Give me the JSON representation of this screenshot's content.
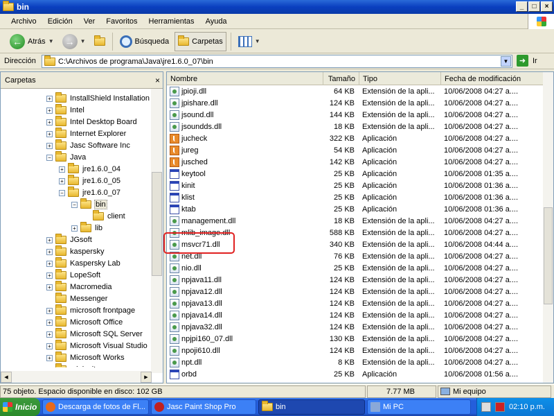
{
  "window": {
    "title": "bin",
    "min": "_",
    "max": "□",
    "close": "×"
  },
  "menu": [
    "Archivo",
    "Edición",
    "Ver",
    "Favoritos",
    "Herramientas",
    "Ayuda"
  ],
  "toolbar": {
    "back": "Atrás",
    "search": "Búsqueda",
    "folders": "Carpetas",
    "back_glyph": "←",
    "fwd_glyph": "→",
    "caret": "▼"
  },
  "address": {
    "label": "Dirección",
    "path": "C:\\Archivos de programa\\Java\\jre1.6.0_07\\bin",
    "go": "Ir",
    "go_glyph": "➜"
  },
  "folders_pane": {
    "title": "Carpetas",
    "close": "×"
  },
  "tree": [
    {
      "label": "InstallShield Installation I",
      "depth": 0,
      "exp": "+"
    },
    {
      "label": "Intel",
      "depth": 0,
      "exp": "+"
    },
    {
      "label": "Intel Desktop Board",
      "depth": 0,
      "exp": "+"
    },
    {
      "label": "Internet Explorer",
      "depth": 0,
      "exp": "+"
    },
    {
      "label": "Jasc Software Inc",
      "depth": 0,
      "exp": "+"
    },
    {
      "label": "Java",
      "depth": 0,
      "exp": "−"
    },
    {
      "label": "jre1.6.0_04",
      "depth": 1,
      "exp": "+"
    },
    {
      "label": "jre1.6.0_05",
      "depth": 1,
      "exp": "+"
    },
    {
      "label": "jre1.6.0_07",
      "depth": 1,
      "exp": "−"
    },
    {
      "label": "bin",
      "depth": 2,
      "exp": "−",
      "selected": true
    },
    {
      "label": "client",
      "depth": 3,
      "exp": ""
    },
    {
      "label": "lib",
      "depth": 2,
      "exp": "+"
    },
    {
      "label": "JGsoft",
      "depth": 0,
      "exp": "+"
    },
    {
      "label": "kaspersky",
      "depth": 0,
      "exp": "+"
    },
    {
      "label": "Kaspersky Lab",
      "depth": 0,
      "exp": "+"
    },
    {
      "label": "LopeSoft",
      "depth": 0,
      "exp": "+"
    },
    {
      "label": "Macromedia",
      "depth": 0,
      "exp": "+"
    },
    {
      "label": "Messenger",
      "depth": 0,
      "exp": ""
    },
    {
      "label": "microsoft frontpage",
      "depth": 0,
      "exp": "+"
    },
    {
      "label": "Microsoft Office",
      "depth": 0,
      "exp": "+"
    },
    {
      "label": "Microsoft SQL Server",
      "depth": 0,
      "exp": "+"
    },
    {
      "label": "Microsoft Visual Studio",
      "depth": 0,
      "exp": "+"
    },
    {
      "label": "Microsoft Works",
      "depth": 0,
      "exp": "+"
    },
    {
      "label": "miniwrite",
      "depth": 0,
      "exp": ""
    }
  ],
  "columns": {
    "name": "Nombre",
    "size": "Tamaño",
    "type": "Tipo",
    "modified": "Fecha de modificación"
  },
  "files": [
    {
      "name": "jpioji.dll",
      "size": "64 KB",
      "type": "Extensión de la apli...",
      "date": "10/06/2008 04:27 a....",
      "icon": "dll"
    },
    {
      "name": "jpishare.dll",
      "size": "124 KB",
      "type": "Extensión de la apli...",
      "date": "10/06/2008 04:27 a....",
      "icon": "dll"
    },
    {
      "name": "jsound.dll",
      "size": "144 KB",
      "type": "Extensión de la apli...",
      "date": "10/06/2008 04:27 a....",
      "icon": "dll"
    },
    {
      "name": "jsoundds.dll",
      "size": "18 KB",
      "type": "Extensión de la apli...",
      "date": "10/06/2008 04:27 a....",
      "icon": "dll"
    },
    {
      "name": "jucheck",
      "size": "322 KB",
      "type": "Aplicación",
      "date": "10/06/2008 04:27 a....",
      "icon": "java"
    },
    {
      "name": "jureg",
      "size": "54 KB",
      "type": "Aplicación",
      "date": "10/06/2008 04:27 a....",
      "icon": "java"
    },
    {
      "name": "jusched",
      "size": "142 KB",
      "type": "Aplicación",
      "date": "10/06/2008 04:27 a....",
      "icon": "java"
    },
    {
      "name": "keytool",
      "size": "25 KB",
      "type": "Aplicación",
      "date": "10/06/2008 01:35 a....",
      "icon": "exe"
    },
    {
      "name": "kinit",
      "size": "25 KB",
      "type": "Aplicación",
      "date": "10/06/2008 01:36 a....",
      "icon": "exe"
    },
    {
      "name": "klist",
      "size": "25 KB",
      "type": "Aplicación",
      "date": "10/06/2008 01:36 a....",
      "icon": "exe"
    },
    {
      "name": "ktab",
      "size": "25 KB",
      "type": "Aplicación",
      "date": "10/06/2008 01:36 a....",
      "icon": "exe"
    },
    {
      "name": "management.dll",
      "size": "18 KB",
      "type": "Extensión de la apli...",
      "date": "10/06/2008 04:27 a....",
      "icon": "dll"
    },
    {
      "name": "mlib_image.dll",
      "size": "588 KB",
      "type": "Extensión de la apli...",
      "date": "10/06/2008 04:27 a....",
      "icon": "dll"
    },
    {
      "name": "msvcr71.dll",
      "size": "340 KB",
      "type": "Extensión de la apli...",
      "date": "10/06/2008 04:44 a....",
      "icon": "dll"
    },
    {
      "name": "net.dll",
      "size": "76 KB",
      "type": "Extensión de la apli...",
      "date": "10/06/2008 04:27 a....",
      "icon": "dll"
    },
    {
      "name": "nio.dll",
      "size": "25 KB",
      "type": "Extensión de la apli...",
      "date": "10/06/2008 04:27 a....",
      "icon": "dll"
    },
    {
      "name": "npjava11.dll",
      "size": "124 KB",
      "type": "Extensión de la apli...",
      "date": "10/06/2008 04:27 a....",
      "icon": "dll"
    },
    {
      "name": "npjava12.dll",
      "size": "124 KB",
      "type": "Extensión de la apli...",
      "date": "10/06/2008 04:27 a....",
      "icon": "dll"
    },
    {
      "name": "npjava13.dll",
      "size": "124 KB",
      "type": "Extensión de la apli...",
      "date": "10/06/2008 04:27 a....",
      "icon": "dll"
    },
    {
      "name": "npjava14.dll",
      "size": "124 KB",
      "type": "Extensión de la apli...",
      "date": "10/06/2008 04:27 a....",
      "icon": "dll"
    },
    {
      "name": "npjava32.dll",
      "size": "124 KB",
      "type": "Extensión de la apli...",
      "date": "10/06/2008 04:27 a....",
      "icon": "dll"
    },
    {
      "name": "npjpi160_07.dll",
      "size": "130 KB",
      "type": "Extensión de la apli...",
      "date": "10/06/2008 04:27 a....",
      "icon": "dll"
    },
    {
      "name": "npoji610.dll",
      "size": "124 KB",
      "type": "Extensión de la apli...",
      "date": "10/06/2008 04:27 a....",
      "icon": "dll"
    },
    {
      "name": "npt.dll",
      "size": "8 KB",
      "type": "Extensión de la apli...",
      "date": "10/06/2008 04:27 a....",
      "icon": "dll"
    },
    {
      "name": "orbd",
      "size": "25 KB",
      "type": "Aplicación",
      "date": "10/06/2008 01:56 a....",
      "icon": "exe"
    }
  ],
  "status": {
    "objects": "75 objeto. Espacio disponible en disco: 102 GB",
    "size": "7.77 MB",
    "location": "Mi equipo"
  },
  "taskbar": {
    "start": "Inicio",
    "tasks": [
      {
        "label": "Descarga de fotos de Fl...",
        "color": "#e86a1a"
      },
      {
        "label": "Jasc Paint Shop Pro",
        "color": "#c02020"
      },
      {
        "label": "bin",
        "color": "#e8b830",
        "active": true
      },
      {
        "label": "Mi PC",
        "color": "#8aa8d8"
      }
    ],
    "clock": "02:10 p.m."
  }
}
